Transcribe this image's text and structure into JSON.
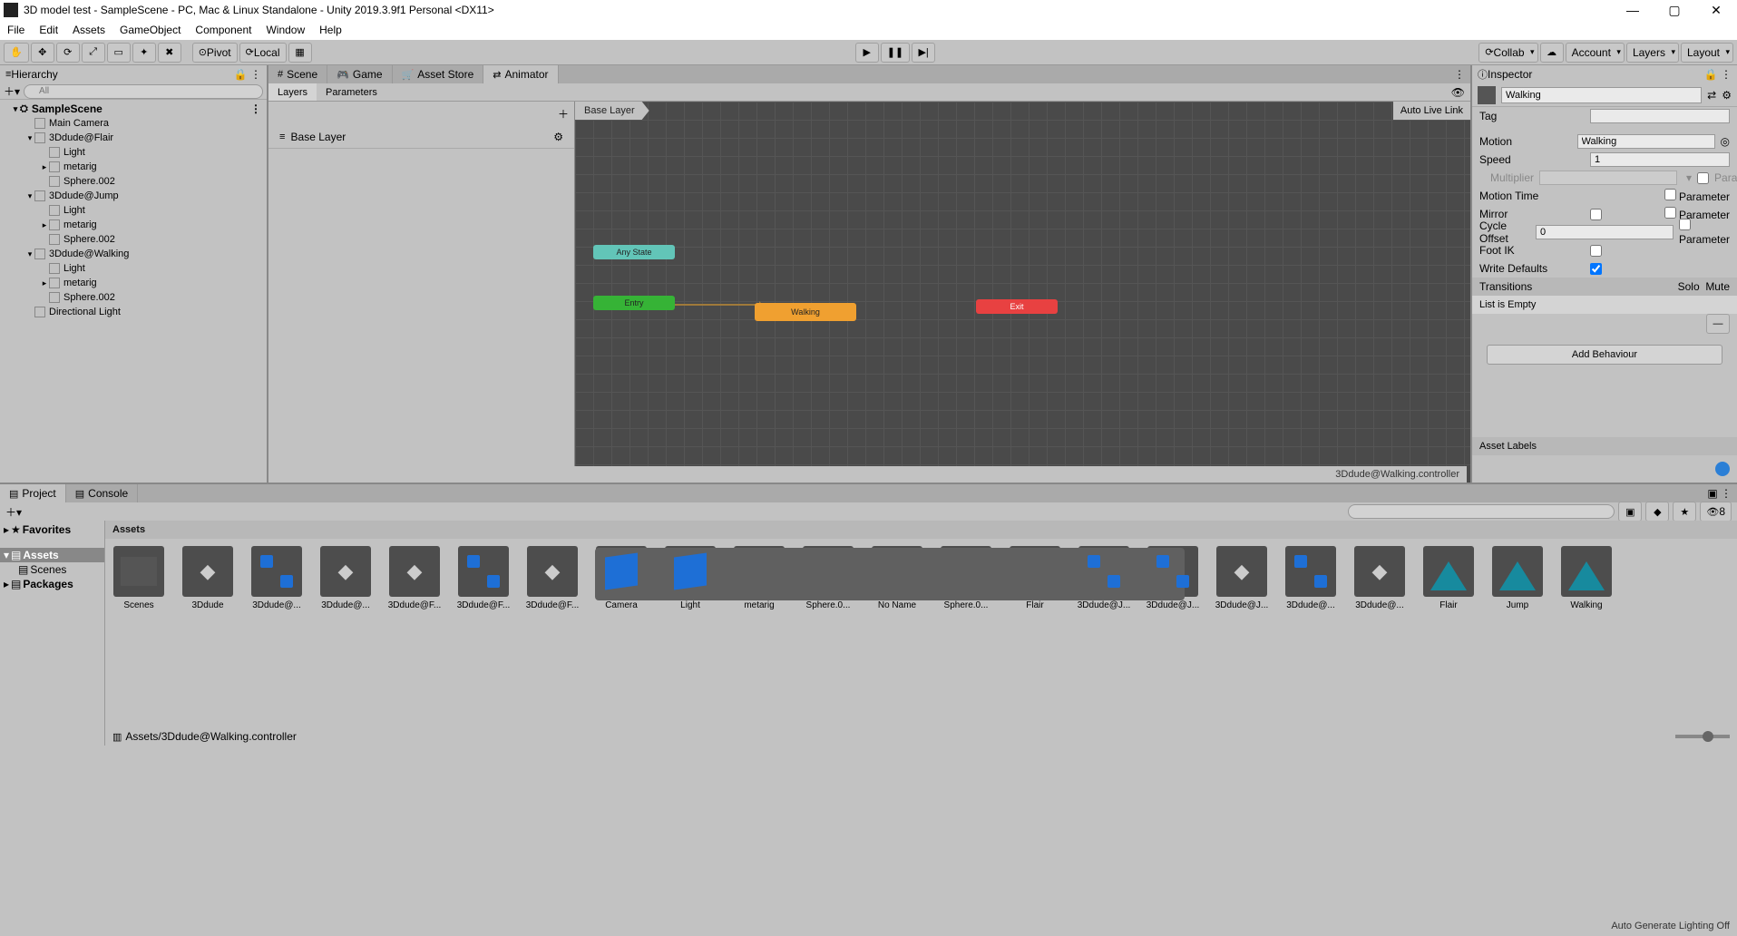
{
  "window": {
    "title": "3D model test - SampleScene - PC, Mac & Linux Standalone - Unity 2019.3.9f1 Personal <DX11>"
  },
  "menu": [
    "File",
    "Edit",
    "Assets",
    "GameObject",
    "Component",
    "Window",
    "Help"
  ],
  "toolbar": {
    "pivot": "Pivot",
    "local": "Local",
    "collab": "Collab",
    "account": "Account",
    "layers": "Layers",
    "layout": "Layout"
  },
  "hierarchy": {
    "title": "Hierarchy",
    "search_placeholder": "All",
    "scene": "SampleScene",
    "nodes": [
      {
        "indent": 1,
        "label": "Main Camera"
      },
      {
        "indent": 1,
        "label": "3Ddude@Flair",
        "expand": true
      },
      {
        "indent": 2,
        "label": "Light"
      },
      {
        "indent": 2,
        "label": "metarig",
        "arrow": true
      },
      {
        "indent": 2,
        "label": "Sphere.002"
      },
      {
        "indent": 1,
        "label": "3Ddude@Jump",
        "expand": true
      },
      {
        "indent": 2,
        "label": "Light"
      },
      {
        "indent": 2,
        "label": "metarig",
        "arrow": true
      },
      {
        "indent": 2,
        "label": "Sphere.002"
      },
      {
        "indent": 1,
        "label": "3Ddude@Walking",
        "expand": true
      },
      {
        "indent": 2,
        "label": "Light"
      },
      {
        "indent": 2,
        "label": "metarig",
        "arrow": true
      },
      {
        "indent": 2,
        "label": "Sphere.002"
      },
      {
        "indent": 1,
        "label": "Directional Light"
      }
    ]
  },
  "center_tabs": [
    "Scene",
    "Game",
    "Asset Store",
    "Animator"
  ],
  "animator": {
    "subtabs": [
      "Layers",
      "Parameters"
    ],
    "layer": "Base Layer",
    "breadcrumb": "Base Layer",
    "autolive": "Auto Live Link",
    "controller": "3Ddude@Walking.controller",
    "nodes": {
      "any": "Any State",
      "entry": "Entry",
      "walking": "Walking",
      "exit": "Exit"
    }
  },
  "inspector": {
    "title": "Inspector",
    "name": "Walking",
    "tag_label": "Tag",
    "motion_label": "Motion",
    "motion_value": "Walking",
    "speed_label": "Speed",
    "speed_value": "1",
    "multiplier_label": "Multiplier",
    "parameter": "Parameter",
    "motiontime_label": "Motion Time",
    "mirror_label": "Mirror",
    "cycle_label": "Cycle Offset",
    "cycle_value": "0",
    "footik_label": "Foot IK",
    "writedef_label": "Write Defaults",
    "transitions": "Transitions",
    "solo": "Solo",
    "mute": "Mute",
    "list_empty": "List is Empty",
    "add_behaviour": "Add Behaviour",
    "asset_labels": "Asset Labels"
  },
  "project": {
    "tabs": [
      "Project",
      "Console"
    ],
    "favorites": "Favorites",
    "assets": "Assets",
    "scenes": "Scenes",
    "packages": "Packages",
    "crumb": "Assets",
    "path": "Assets/3Ddude@Walking.controller",
    "hidden_count": "8",
    "items": [
      {
        "name": "Scenes",
        "type": "folder"
      },
      {
        "name": "3Ddude",
        "type": "model"
      },
      {
        "name": "3Ddude@...",
        "type": "anim"
      },
      {
        "name": "3Ddude@...",
        "type": "model"
      },
      {
        "name": "3Ddude@F...",
        "type": "model"
      },
      {
        "name": "3Ddude@F...",
        "type": "anim"
      },
      {
        "name": "3Ddude@F...",
        "type": "model"
      },
      {
        "name": "Camera",
        "type": "cube"
      },
      {
        "name": "Light",
        "type": "cube"
      },
      {
        "name": "metarig",
        "type": "bone"
      },
      {
        "name": "Sphere.0...",
        "type": "sphere"
      },
      {
        "name": "No Name",
        "type": "sphere"
      },
      {
        "name": "Sphere.0...",
        "type": "bone"
      },
      {
        "name": "Flair",
        "type": "tri"
      },
      {
        "name": "3Ddude@J...",
        "type": "anim"
      },
      {
        "name": "3Ddude@J...",
        "type": "anim"
      },
      {
        "name": "3Ddude@J...",
        "type": "model"
      },
      {
        "name": "3Ddude@...",
        "type": "anim"
      },
      {
        "name": "3Ddude@...",
        "type": "model"
      },
      {
        "name": "Flair",
        "type": "tri"
      },
      {
        "name": "Jump",
        "type": "tri"
      },
      {
        "name": "Walking",
        "type": "tri"
      }
    ]
  },
  "status": "Auto Generate Lighting Off"
}
